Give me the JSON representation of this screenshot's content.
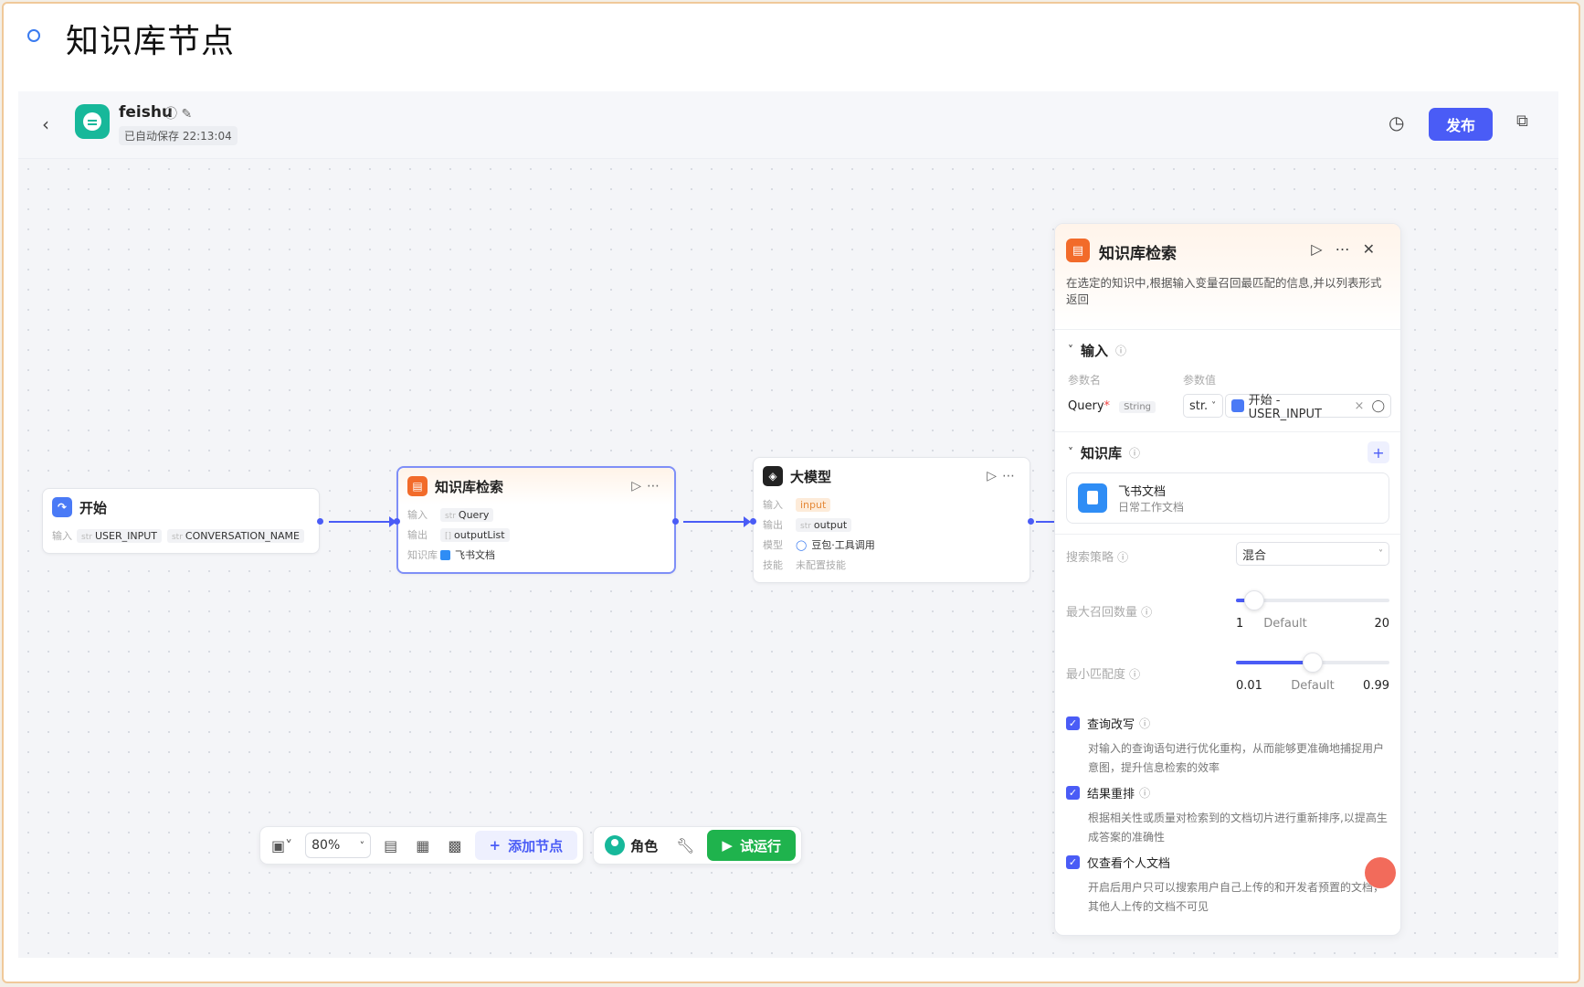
{
  "page": {
    "title": "知识库节点"
  },
  "header": {
    "app_name": "feishu",
    "autosave": "已自动保存 22:13:04",
    "publish_label": "发布"
  },
  "nodes": {
    "start": {
      "title": "开始",
      "input_label": "输入",
      "inputs": [
        {
          "type": "str",
          "name": "USER_INPUT"
        },
        {
          "type": "str",
          "name": "CONVERSATION_NAME"
        }
      ]
    },
    "kb": {
      "title": "知识库检索",
      "input_label": "输入",
      "input": {
        "type": "str",
        "name": "Query"
      },
      "output_label": "输出",
      "output": {
        "type": "[]",
        "name": "outputList"
      },
      "kb_label": "知识库",
      "kb_value": "飞书文档"
    },
    "llm": {
      "title": "大模型",
      "input_label": "输入",
      "input": "input",
      "output_label": "输出",
      "output": {
        "type": "str",
        "name": "output"
      },
      "model_label": "模型",
      "model_value": "豆包·工具调用",
      "skill_label": "技能",
      "skill_value": "未配置技能"
    }
  },
  "toolbar": {
    "zoom": "80%",
    "add_node": "添加节点",
    "role": "角色",
    "run": "试运行"
  },
  "panel": {
    "title": "知识库检索",
    "description": "在选定的知识中,根据输入变量召回最匹配的信息,并以列表形式返回",
    "input_section": {
      "title": "输入",
      "col_name": "参数名",
      "col_value": "参数值",
      "param_name": "Query",
      "param_required": "*",
      "param_type": "String",
      "value_type": "str.",
      "value_ref": "开始 - USER_INPUT"
    },
    "kb_section": {
      "title": "知识库",
      "item_name": "飞书文档",
      "item_desc": "日常工作文档"
    },
    "search_strategy": {
      "label": "搜索策略",
      "value": "混合"
    },
    "max_recall": {
      "label": "最大召回数量",
      "min": "1",
      "default_label": "Default",
      "max": "20",
      "value_fraction": 0.12
    },
    "min_match": {
      "label": "最小匹配度",
      "min": "0.01",
      "default_label": "Default",
      "max": "0.99",
      "value_fraction": 0.5
    },
    "options": [
      {
        "label": "查询改写",
        "checked": true,
        "desc": "对输入的查询语句进行优化重构，从而能够更准确地捕捉用户意图，提升信息检索的效率"
      },
      {
        "label": "结果重排",
        "checked": true,
        "desc": "根据相关性或质量对检索到的文档切片进行重新排序,以提高生成答案的准确性"
      },
      {
        "label": "仅查看个人文档",
        "checked": true,
        "desc": "开启后用户只可以搜索用户自己上传的和开发者预置的文档，其他人上传的文档不可见"
      }
    ]
  },
  "colors": {
    "accent": "#4a5cf6",
    "run_green": "#1fb34d",
    "kb_orange": "#f26b2a",
    "logo_teal": "#17b89a"
  }
}
